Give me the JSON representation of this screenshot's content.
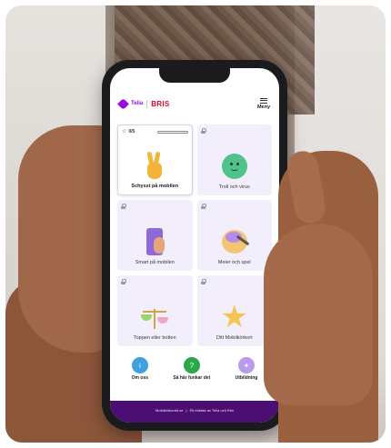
{
  "header": {
    "telia_label": "Telia",
    "bris_label": "BRIS",
    "menu_label": "Meny"
  },
  "tiles": [
    {
      "label": "Schysst på mobilen",
      "progress_text": "0/5",
      "progress": 0.0,
      "active": true,
      "icon": "peace-hand-icon"
    },
    {
      "label": "Troll och virus",
      "active": false,
      "icon": "virus-icon"
    },
    {
      "label": "Smart på mobilen",
      "active": false,
      "icon": "phone-hand-icon"
    },
    {
      "label": "Meier och spel",
      "active": false,
      "icon": "palette-icon"
    },
    {
      "label": "Toppen eller botten",
      "active": false,
      "icon": "scales-icon"
    },
    {
      "label": "Ditt Mobilkörkort",
      "active": false,
      "icon": "star-icon"
    }
  ],
  "links": [
    {
      "label": "Om oss",
      "icon": "info-icon"
    },
    {
      "label": "Så här funkar det",
      "icon": "question-icon"
    },
    {
      "label": "Utbildning",
      "icon": "lightbulb-icon"
    }
  ],
  "footer": {
    "site": "Mobilkörkortet.se",
    "separator": "|",
    "tagline": "Ett initiativ av Telia och Bris"
  },
  "colors": {
    "telia_purple": "#990ae3",
    "bris_red": "#e4002b",
    "footer_bg": "#4b0f74"
  }
}
